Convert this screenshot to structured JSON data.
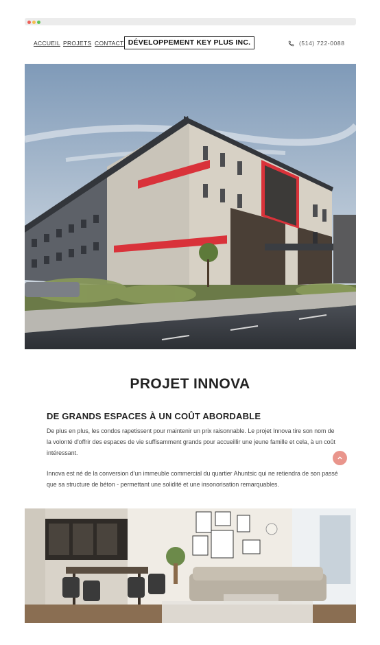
{
  "nav": {
    "items": [
      "ACCUEIL",
      "PROJETS",
      "CONTACT"
    ],
    "brand": "DÉVELOPPEMENT KEY PLUS INC.",
    "phone": "(514) 722-0088"
  },
  "project": {
    "title": "PROJET INNOVA",
    "subtitle": "DE GRANDS ESPACES À UN COÛT ABORDABLE",
    "paragraph1": "De plus en plus, les condos rapetissent pour maintenir un prix raisonnable. Le projet Innova tire son nom de la volonté d'offrir des espaces de vie suffisamment grands pour accueillir une jeune famille et cela, à un coût intéressant.",
    "paragraph2": "Innova est né de la conversion d'un immeuble commercial du quartier Ahuntsic qui ne retiendra de son passé que sa structure de béton - permettant une solidité et une insonorisation remarquables."
  },
  "icons": {
    "phone": "phone-icon",
    "back_to_top": "chevron-up-icon"
  },
  "colors": {
    "accent_red": "#d9323a",
    "back_to_top": "#e9958c"
  }
}
